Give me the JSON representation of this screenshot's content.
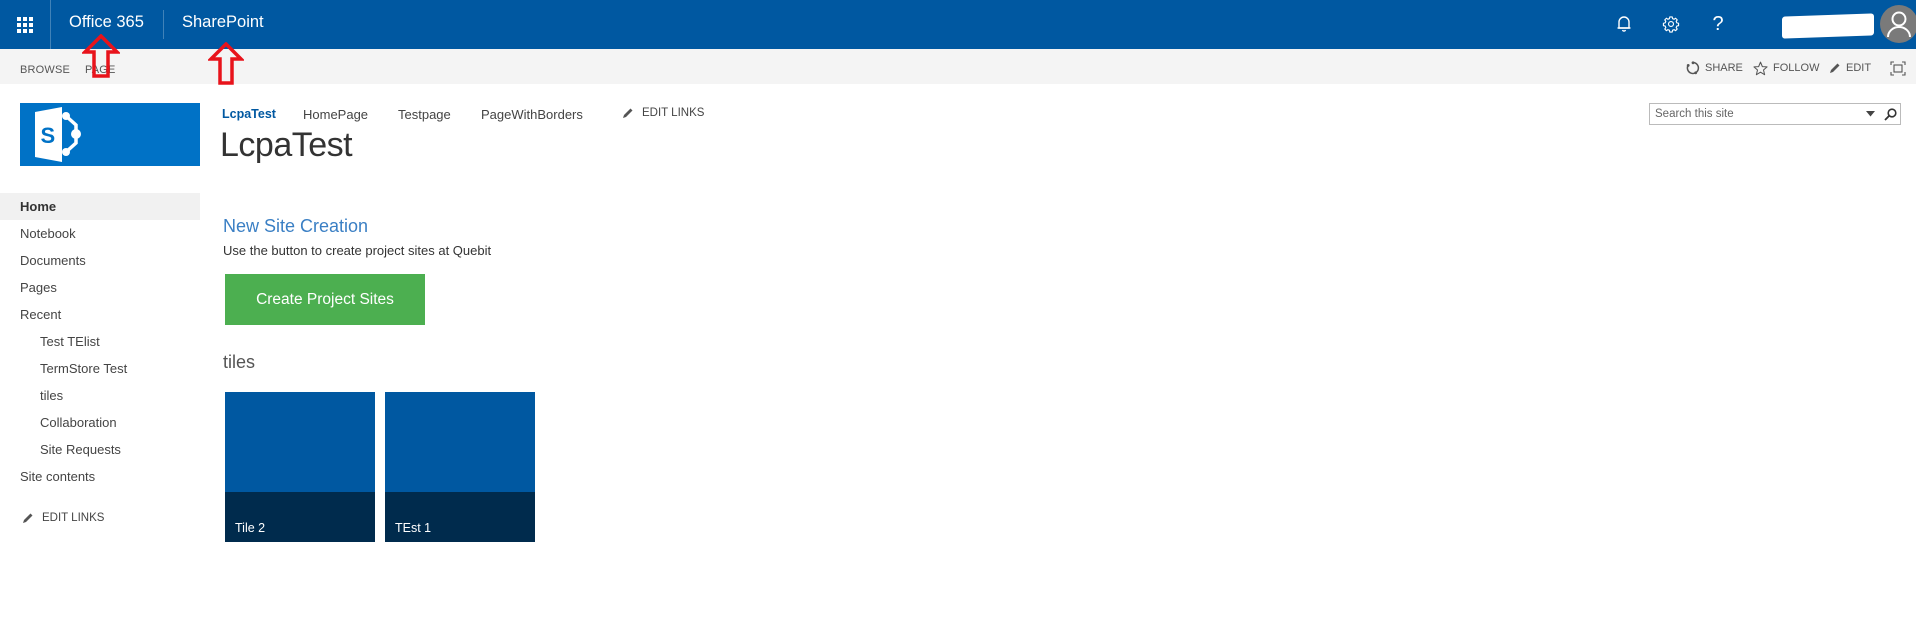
{
  "suite_bar": {
    "app_launcher_icon": "waffle-grid-icon",
    "brand": "Office 365",
    "app_name": "SharePoint",
    "icons": [
      "bell-icon",
      "gear-icon",
      "help-icon"
    ],
    "help_glyph": "?",
    "user_name": "[redacted]",
    "avatar_icon": "user-avatar-icon",
    "background_color": "#0058a1"
  },
  "ribbon": {
    "tabs": [
      {
        "label": "BROWSE"
      },
      {
        "label": "PAGE"
      }
    ],
    "actions": [
      {
        "label": "SHARE",
        "icon": "share-icon"
      },
      {
        "label": "FOLLOW",
        "icon": "star-icon"
      },
      {
        "label": "EDIT",
        "icon": "pencil-icon"
      },
      {
        "label": "",
        "icon": "focus-content-icon"
      }
    ]
  },
  "site": {
    "logo_icon": "sharepoint-logo-icon",
    "title": "LcpaTest"
  },
  "top_nav": {
    "items": [
      {
        "label": "LcpaTest",
        "active": true
      },
      {
        "label": "HomePage",
        "active": false
      },
      {
        "label": "Testpage",
        "active": false
      },
      {
        "label": "PageWithBorders",
        "active": false
      }
    ],
    "edit_links_label": "EDIT LINKS"
  },
  "search": {
    "placeholder": "Search this site",
    "value": ""
  },
  "quick_launch": {
    "items": [
      {
        "label": "Home",
        "selected": true,
        "level": 1
      },
      {
        "label": "Notebook",
        "selected": false,
        "level": 1
      },
      {
        "label": "Documents",
        "selected": false,
        "level": 1
      },
      {
        "label": "Pages",
        "selected": false,
        "level": 1
      },
      {
        "label": "Recent",
        "selected": false,
        "level": 1
      },
      {
        "label": "Test TElist",
        "selected": false,
        "level": 2
      },
      {
        "label": "TermStore Test",
        "selected": false,
        "level": 2
      },
      {
        "label": "tiles",
        "selected": false,
        "level": 2
      },
      {
        "label": "Collaboration",
        "selected": false,
        "level": 2
      },
      {
        "label": "Site Requests",
        "selected": false,
        "level": 2
      },
      {
        "label": "Site contents",
        "selected": false,
        "level": 1
      }
    ],
    "edit_links_label": "EDIT LINKS"
  },
  "main": {
    "section_heading": "New Site Creation",
    "section_description": "Use the button to create project sites at Quebit",
    "create_button_label": "Create Project Sites",
    "create_button_color": "#4caf50",
    "tiles_heading": "tiles",
    "tiles": [
      {
        "title": "Tile 2"
      },
      {
        "title": "TEst 1"
      }
    ],
    "tile_color": "#0058a1",
    "tile_caption_color": "#002b4d"
  },
  "annotations": {
    "arrow_color": "#e8131b",
    "arrows": [
      "points-to-office-365",
      "points-to-sharepoint"
    ]
  }
}
